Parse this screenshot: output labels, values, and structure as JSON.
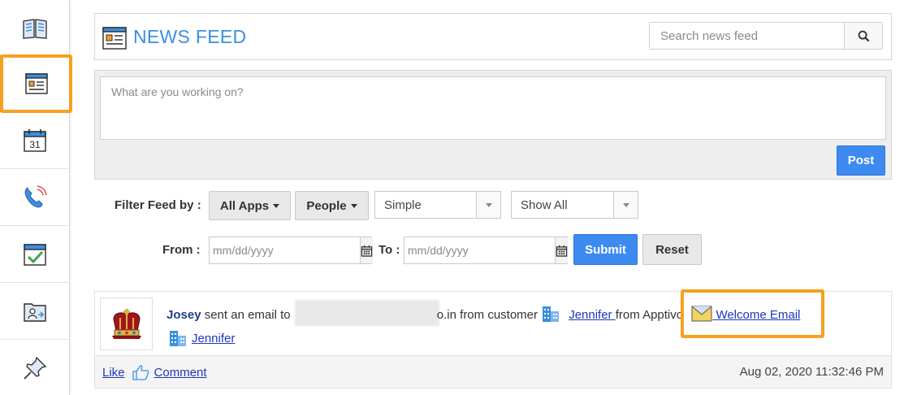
{
  "sidebar": {
    "items": [
      {
        "name": "book-icon",
        "active": false
      },
      {
        "name": "news-feed-icon",
        "active": true
      },
      {
        "name": "calendar-icon",
        "label": "31",
        "active": false
      },
      {
        "name": "phone-icon",
        "active": false
      },
      {
        "name": "tasks-icon",
        "active": false
      },
      {
        "name": "contacts-icon",
        "active": false
      },
      {
        "name": "pin-icon",
        "active": false
      }
    ]
  },
  "header": {
    "title": "NEWS FEED",
    "search_placeholder": "Search news feed"
  },
  "post": {
    "placeholder": "What are you working on?",
    "button_label": "Post"
  },
  "filter": {
    "label": "Filter Feed by :",
    "apps_label": "All Apps",
    "people_label": "People",
    "view_value": "Simple",
    "show_value": "Show All",
    "from_label": "From :",
    "from_placeholder": "mm/dd/yyyy",
    "to_label": "To :",
    "to_placeholder": "mm/dd/yyyy",
    "submit_label": "Submit",
    "reset_label": "Reset"
  },
  "feed_item": {
    "author": "Josey",
    "action_text": "sent an email to",
    "email_suffix": "o.in from customer",
    "customer_link": "Jennifer ",
    "from_text": "from Apptivo",
    "email_subject_link": " Welcome Email",
    "second_account_link": "Jennifer",
    "like_label": "Like",
    "comment_label": "Comment",
    "timestamp": "Aug 02, 2020 11:32:46 PM"
  },
  "colors": {
    "accent": "#3b8fe0",
    "button_blue": "#3d8af0",
    "highlight": "#f5a020",
    "link": "#1d37b8"
  }
}
